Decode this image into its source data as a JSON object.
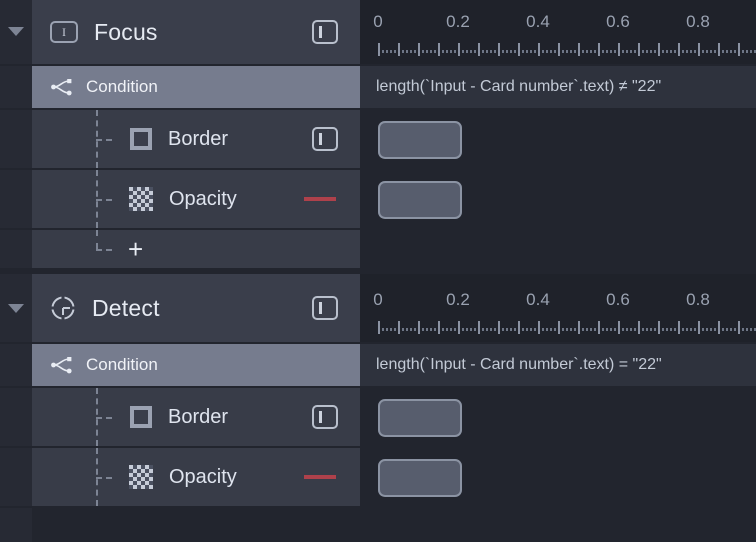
{
  "app": {
    "theme_bg": "#22252e",
    "accent_selected": "#767c8e",
    "hidden_marker_color": "#b4414c"
  },
  "ruler": {
    "tick_labels": [
      "0",
      "0.2",
      "0.4",
      "0.6",
      "0.8"
    ],
    "tick_values": [
      0,
      0.2,
      0.4,
      0.6,
      0.8
    ],
    "minor_step": 0.01,
    "major_step": 0.05,
    "range_start": 0,
    "range_end": 1.0
  },
  "sections": [
    {
      "name": "focus",
      "header": {
        "label": "Focus",
        "icon": "text-cursor-box-icon",
        "right_button_icon": "keyframe-panel-icon",
        "disclosure": "expanded"
      },
      "condition": {
        "label": "Condition",
        "icon": "branch-icon",
        "expression": "length(`Input - Card number`.text) ≠ \"22\""
      },
      "properties": [
        {
          "label": "Border",
          "icon": "border-square-icon",
          "right_button_icon": "keyframe-panel-icon",
          "has_clip": true,
          "hidden_marker": false
        },
        {
          "label": "Opacity",
          "icon": "checkerboard-icon",
          "right_button_icon": null,
          "has_clip": true,
          "hidden_marker": true
        }
      ],
      "add_row": {
        "label": "+",
        "icon": "plus-icon"
      }
    },
    {
      "name": "detect",
      "header": {
        "label": "Detect",
        "icon": "crosshair-target-icon",
        "right_button_icon": "keyframe-panel-icon",
        "disclosure": "expanded"
      },
      "condition": {
        "label": "Condition",
        "icon": "branch-icon",
        "expression": "length(`Input - Card number`.text) = \"22\""
      },
      "properties": [
        {
          "label": "Border",
          "icon": "border-square-icon",
          "right_button_icon": "keyframe-panel-icon",
          "has_clip": true,
          "hidden_marker": false
        },
        {
          "label": "Opacity",
          "icon": "checkerboard-icon",
          "right_button_icon": null,
          "has_clip": true,
          "hidden_marker": true
        }
      ]
    }
  ]
}
